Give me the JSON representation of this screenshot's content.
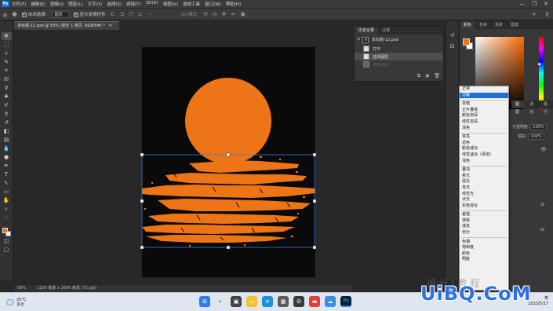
{
  "app": {
    "logo": "Ps",
    "menu": [
      "文件(F)",
      "编辑(E)",
      "图像(I)",
      "图层(L)",
      "文字(Y)",
      "选择(S)",
      "滤镜(T)",
      "3D(D)",
      "视图(V)",
      "增效工具",
      "窗口(W)",
      "帮助(H)"
    ],
    "window_controls": [
      "—",
      "❐",
      "✕"
    ]
  },
  "options": {
    "auto_select_label": "自动选择:",
    "auto_select_value": "图层",
    "show_transform_label": "显示变换控件",
    "mode_label": "3D 模式:"
  },
  "document": {
    "tab_title": "未标题-12.psd @ 50% (矩形 1 拷贝, RGB/8#) *",
    "zoom": "50%",
    "size_info": "1200 像素 x 1600 像素 (72 ppi)"
  },
  "history": {
    "tabs": [
      "历史记录",
      "注释"
    ],
    "snapshot_name": "未标题-12.psd",
    "states": [
      {
        "label": "打开",
        "state": "normal"
      },
      {
        "label": "选择图层",
        "state": "selected"
      },
      {
        "label": "更改混合",
        "state": "dimmed"
      }
    ]
  },
  "color_panel": {
    "tabs": [
      "颜色",
      "色板",
      "渐变",
      "图案"
    ],
    "fg_color": "#ee7516",
    "bg_color": "#ffffff"
  },
  "layers_panel": {
    "tabs": [
      "图层",
      "通道",
      "路径"
    ],
    "opacity_label": "不透明度:",
    "opacity_value": "100%",
    "fill_label": "填充:",
    "fill_value": "100%"
  },
  "blend_modes": {
    "selected": "溶解",
    "groups": [
      [
        "正常",
        "溶解"
      ],
      [
        "变暗",
        "正片叠底",
        "颜色加深",
        "线性加深",
        "深色"
      ],
      [
        "变亮",
        "滤色",
        "颜色减淡",
        "线性减淡（添加）",
        "浅色"
      ],
      [
        "叠加",
        "柔光",
        "强光",
        "亮光",
        "线性光",
        "点光",
        "实色混合"
      ],
      [
        "差值",
        "排除",
        "减去",
        "划分"
      ],
      [
        "色相",
        "饱和度",
        "颜色",
        "明度"
      ]
    ]
  },
  "taskbar": {
    "weather_temp": "25°C",
    "weather_desc": "多云",
    "language": "英",
    "date": "2023/5/17"
  },
  "watermark": {
    "text_cn": "设 计 | 教 程",
    "logo_text": "UiBQ.CoM"
  },
  "colors": {
    "accent": "#ee7516",
    "selection": "#1f6fd1"
  }
}
